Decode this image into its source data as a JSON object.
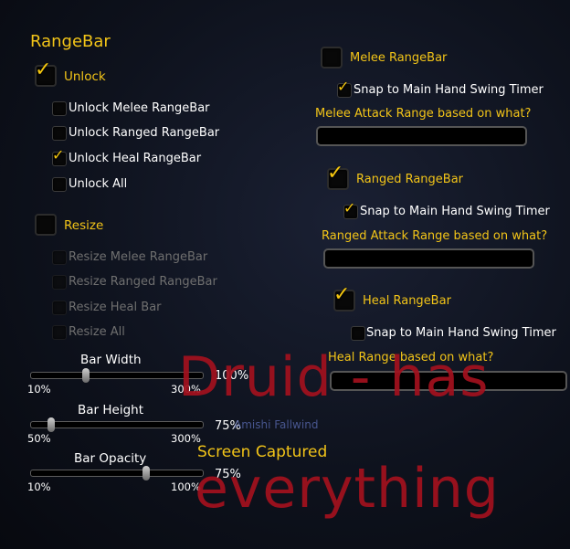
{
  "panel": {
    "title": "RangeBar"
  },
  "left": {
    "unlock": {
      "label": "Unlock",
      "checked": true
    },
    "unlock_items": [
      {
        "label": "Unlock Melee RangeBar",
        "checked": false
      },
      {
        "label": "Unlock Ranged RangeBar",
        "checked": false
      },
      {
        "label": "Unlock Heal RangeBar",
        "checked": true
      },
      {
        "label": "Unlock All",
        "checked": false
      }
    ],
    "resize": {
      "label": "Resize",
      "checked": false
    },
    "resize_items": [
      {
        "label": "Resize Melee RangeBar"
      },
      {
        "label": "Resize Ranged RangeBar"
      },
      {
        "label": "Resize Heal Bar"
      },
      {
        "label": "Resize All"
      }
    ],
    "sliders": [
      {
        "label": "Bar Width",
        "min": "10%",
        "max": "300%",
        "value_text": "100%",
        "value": 0.31
      },
      {
        "label": "Bar Height",
        "min": "50%",
        "max": "300%",
        "value_text": "75%",
        "value": 0.1
      },
      {
        "label": "Bar Opacity",
        "min": "10%",
        "max": "100%",
        "value_text": "75%",
        "value": 0.68
      }
    ]
  },
  "right": {
    "melee": {
      "label": "Melee RangeBar",
      "checked": false,
      "snap_label": "Snap to Main Hand Swing Timer",
      "snap_checked": true,
      "range_label": "Melee Attack Range based on what?",
      "range_value": ""
    },
    "ranged": {
      "label": "Ranged RangeBar",
      "checked": true,
      "snap_label": "Snap to Main Hand Swing Timer",
      "snap_checked": true,
      "range_label": "Ranged Attack Range based on what?",
      "range_value": ""
    },
    "heal": {
      "label": "Heal RangeBar",
      "checked": true,
      "snap_label": "Snap to Main Hand Swing Timer",
      "snap_checked": false,
      "range_label": "Heal Range based on what?",
      "range_value": ""
    }
  },
  "overlay": {
    "line1": "Druid - has",
    "line2": "everything",
    "captured": "Screen Captured",
    "background_name": "Amishi Fallwind"
  },
  "colors": {
    "accent": "#f2c418",
    "overlay_red": "#a3111e",
    "background": "#0e121d"
  }
}
